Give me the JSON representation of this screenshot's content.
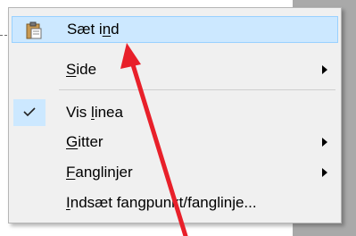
{
  "menu": {
    "items": [
      {
        "pre": "Sæt i",
        "ul": "n",
        "post": "d"
      },
      {
        "pre": "",
        "ul": "S",
        "post": "ide"
      },
      {
        "pre": "Vis ",
        "ul": "l",
        "post": "inea"
      },
      {
        "pre": "",
        "ul": "G",
        "post": "itter"
      },
      {
        "pre": "",
        "ul": "F",
        "post": "anglinjer"
      },
      {
        "pre": "",
        "ul": "I",
        "post": "ndsæt fangpunkt/fanglinje..."
      }
    ]
  },
  "annotation": {
    "arrow_color": "#e8202a"
  },
  "colors": {
    "highlight_bg": "#cce8ff",
    "highlight_border": "#99d1ff",
    "menu_bg": "#f0f0f0"
  }
}
